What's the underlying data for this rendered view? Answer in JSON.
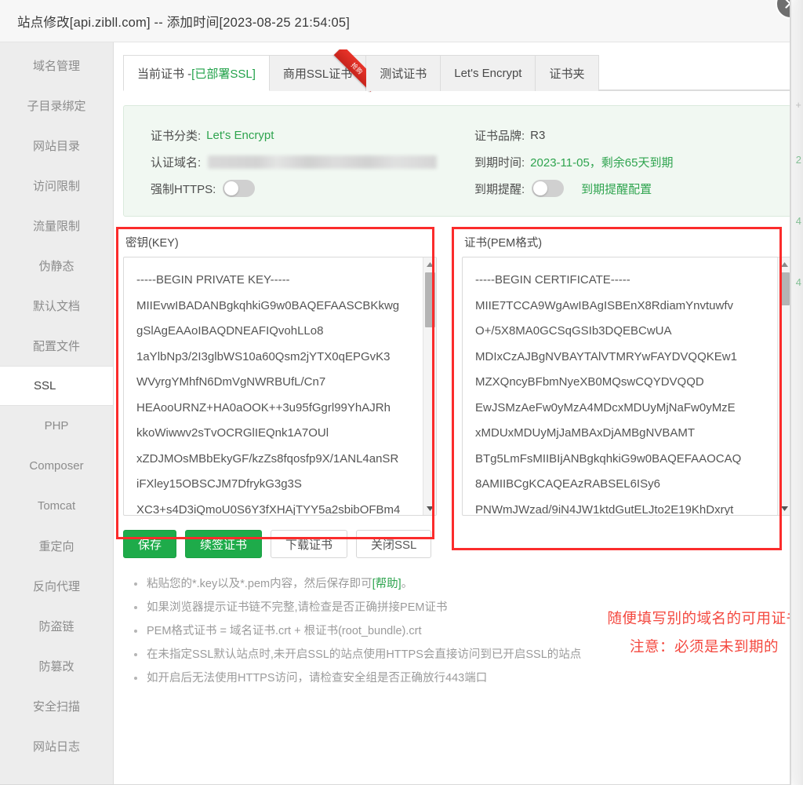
{
  "window": {
    "title": "站点修改[api.zibll.com] -- 添加时间[2023-08-25 21:54:05]",
    "close_icon": "close-icon"
  },
  "sidebar": {
    "items": [
      {
        "label": "域名管理",
        "active": false
      },
      {
        "label": "子目录绑定",
        "active": false
      },
      {
        "label": "网站目录",
        "active": false
      },
      {
        "label": "访问限制",
        "active": false
      },
      {
        "label": "流量限制",
        "active": false
      },
      {
        "label": "伪静态",
        "active": false
      },
      {
        "label": "默认文档",
        "active": false
      },
      {
        "label": "配置文件",
        "active": false
      },
      {
        "label": "SSL",
        "active": true
      },
      {
        "label": "PHP",
        "active": false
      },
      {
        "label": "Composer",
        "active": false
      },
      {
        "label": "Tomcat",
        "active": false
      },
      {
        "label": "重定向",
        "active": false
      },
      {
        "label": "反向代理",
        "active": false
      },
      {
        "label": "防盗链",
        "active": false
      },
      {
        "label": "防篡改",
        "active": false
      },
      {
        "label": "安全扫描",
        "active": false
      },
      {
        "label": "网站日志",
        "active": false
      }
    ]
  },
  "tabs": {
    "items": [
      {
        "label": "当前证书 - ",
        "suffix": "[已部署SSL]",
        "active": true,
        "badge": ""
      },
      {
        "label": "商用SSL证书",
        "suffix": "",
        "active": false,
        "badge": "抢购"
      },
      {
        "label": "测试证书",
        "suffix": "",
        "active": false,
        "badge": ""
      },
      {
        "label": "Let's Encrypt",
        "suffix": "",
        "active": false,
        "badge": ""
      },
      {
        "label": "证书夹",
        "suffix": "",
        "active": false,
        "badge": ""
      }
    ]
  },
  "info": {
    "cert_type_label": "证书分类:",
    "cert_type_value": "Let's Encrypt",
    "cert_brand_label": "证书品牌:",
    "cert_brand_value": "R3",
    "domain_label": "认证域名:",
    "domain_value": "",
    "expire_label": "到期时间:",
    "expire_value": "2023-11-05，剩余65天到期",
    "force_https_label": "强制HTTPS:",
    "force_https_state": "off",
    "expire_notice_label": "到期提醒:",
    "expire_notice_state": "off",
    "expire_notice_link": "到期提醒配置"
  },
  "editors": {
    "key": {
      "label": "密钥(KEY)",
      "content": "-----BEGIN PRIVATE KEY-----\nMIIEvwIBADANBgkqhkiG9w0BAQEFAASCBKkwg\ngSlAgEAAoIBAQDNEAFIQvohLLo8\n1aYlbNp3/2I3glbWS10a60Qsm2jYTX0qEPGvK3\nWVyrgYMhfN6DmVgNWRBUfL/Cn7\nHEAooURNZ+HA0aOOK++3u95fGgrl99YhAJRh\nkkoWiwwv2sTvOCRGlIEQnk1A7OUl\nxZDJMOsMBbEkyGF/kzZs8fqosfp9X/1ANL4anSR\niFXley15OBSCJM7DfrykG3g3S\nXC3+s4D3iQmoU0S6Y3fXHAjTYY5a2sbibOFBm4"
    },
    "pem": {
      "label": "证书(PEM格式)",
      "content": "-----BEGIN CERTIFICATE-----\nMIIE7TCCA9WgAwIBAgISBEnX8RdiamYnvtuwfv\nO+/5X8MA0GCSqGSIb3DQEBCwUA\nMDIxCzAJBgNVBAYTAlVTMRYwFAYDVQQKEw1\nMZXQncyBFbmNyeXB0MQswCQYDVQQD\nEwJSMzAeFw0yMzA4MDcxMDUyMjNaFw0yMzE\nxMDUxMDUyMjJaMBAxDjAMBgNVBAMT\nBTg5LmFsMIIBIjANBgkqhkiG9w0BAQEFAAOCAQ\n8AMIIBCgKCAQEAzRABSEL6ISy6\nPNWmJWzad/9iN4JW1ktdGutELJto2E19KhDxryt"
    }
  },
  "actions": {
    "buttons": [
      {
        "label": "保存",
        "style": "primary"
      },
      {
        "label": "续签证书",
        "style": "primary"
      },
      {
        "label": "下载证书",
        "style": "ghost"
      },
      {
        "label": "关闭SSL",
        "style": "ghost"
      }
    ]
  },
  "tips": {
    "items": [
      {
        "pre": "粘贴您的*.key以及*.pem内容，然后保存即可",
        "link": "[帮助]",
        "post": "。"
      },
      {
        "pre": "如果浏览器提示证书链不完整,请检查是否正确拼接PEM证书",
        "link": "",
        "post": ""
      },
      {
        "pre": "PEM格式证书 = 域名证书.crt + 根证书(root_bundle).crt",
        "link": "",
        "post": ""
      },
      {
        "pre": "在未指定SSL默认站点时,未开启SSL的站点使用HTTPS会直接访问到已开启SSL的站点",
        "link": "",
        "post": ""
      },
      {
        "pre": "如开启后无法使用HTTPS访问，请检查安全组是否正确放行443端口",
        "link": "",
        "post": ""
      }
    ]
  },
  "annotations": {
    "lines": [
      "随便填写别的域名的可用证书",
      "注意：必须是未到期的"
    ],
    "color": "#f4483f"
  },
  "colors": {
    "accent_green": "#1eab4a",
    "link_green": "#2fa44f",
    "annotation_red": "#f4483f",
    "outline_red": "#fb2c2c",
    "sidebar_bg": "#ededed",
    "info_panel_bg": "#f1f8f2"
  }
}
